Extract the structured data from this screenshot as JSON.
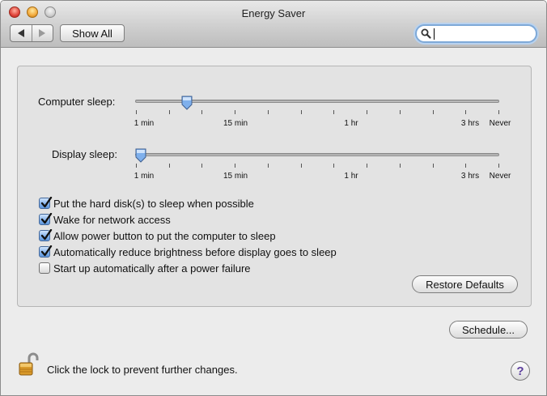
{
  "window": {
    "title": "Energy Saver"
  },
  "toolbar": {
    "back_icon": "back-arrow-icon",
    "forward_icon": "forward-arrow-icon",
    "show_all_label": "Show All",
    "search": {
      "value": "",
      "placeholder": "",
      "icon": "search-icon"
    }
  },
  "sliders": {
    "computer_sleep": {
      "label": "Computer sleep:",
      "ticks": [
        "1 min",
        "15 min",
        "1 hr",
        "3 hrs",
        "Never"
      ],
      "value": "10 min"
    },
    "display_sleep": {
      "label": "Display sleep:",
      "ticks": [
        "1 min",
        "15 min",
        "1 hr",
        "3 hrs",
        "Never"
      ],
      "value": "1 min"
    }
  },
  "options": [
    {
      "label": "Put the hard disk(s) to sleep when possible",
      "checked": true
    },
    {
      "label": "Wake for network access",
      "checked": true
    },
    {
      "label": "Allow power button to put the computer to sleep",
      "checked": true
    },
    {
      "label": "Automatically reduce brightness before display goes to sleep",
      "checked": true
    },
    {
      "label": "Start up automatically after a power failure",
      "checked": false
    }
  ],
  "buttons": {
    "restore_defaults": "Restore Defaults",
    "schedule": "Schedule..."
  },
  "footer": {
    "lock_text": "Click the lock to prevent further changes.",
    "lock_icon": "padlock-open-icon",
    "help_label": "?"
  },
  "colors": {
    "accent": "#5f97dc",
    "help": "#5b3d9c"
  }
}
